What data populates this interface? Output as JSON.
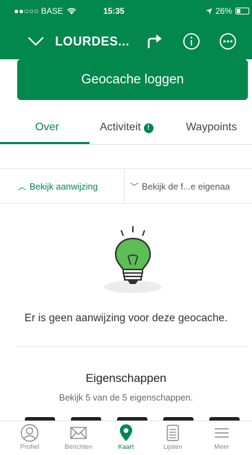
{
  "status_bar": {
    "carrier": "●●○○○ BASE",
    "time": "15:35",
    "battery": "26%"
  },
  "nav": {
    "title": "LOURDES..."
  },
  "log_button_label": "Geocache loggen",
  "tabs": [
    {
      "label": "Over",
      "active": true
    },
    {
      "label": "Activiteit",
      "badge": "!"
    },
    {
      "label": "Waypoints"
    }
  ],
  "hint_tabs": {
    "show_hint": "Bekijk aanwijzing",
    "show_owner": "Bekijk de f...e eigenaa"
  },
  "hint_message": "Er is geen aanwijzing voor deze geocache.",
  "properties": {
    "title": "Eigenschappen",
    "subtitle": "Bekijk 5 van de 5 eigenschappen."
  },
  "tab_bar": [
    {
      "label": "Profiel",
      "icon": "profile-icon"
    },
    {
      "label": "Berichten",
      "icon": "mail-icon"
    },
    {
      "label": "Kaart",
      "icon": "map-pin-icon",
      "active": true
    },
    {
      "label": "Lijsten",
      "icon": "list-icon"
    },
    {
      "label": "Meer",
      "icon": "menu-icon"
    }
  ],
  "colors": {
    "brand": "#02874d"
  }
}
